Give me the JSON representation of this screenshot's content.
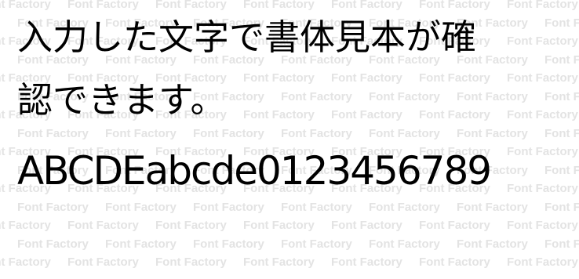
{
  "watermark": {
    "text": "Font Factory",
    "color": "#e3e3e3"
  },
  "sample": {
    "line1": "入力した文字で書体見本が確",
    "line2": "認できます。",
    "line3": "ABCDEabcde0123456789"
  }
}
